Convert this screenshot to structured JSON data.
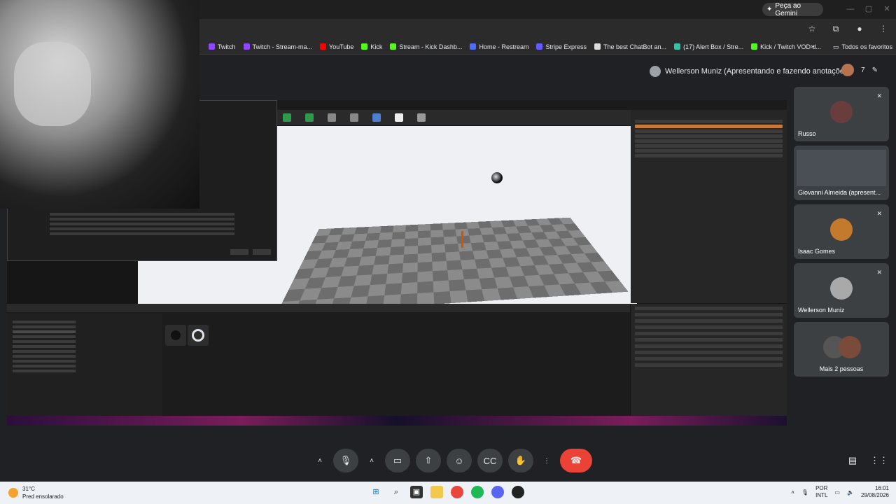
{
  "browser": {
    "gemini_label": "Peça ao Gemini",
    "bookmarks": [
      {
        "label": "Twitch",
        "color": "#9146ff"
      },
      {
        "label": "Twitch - Stream-ma...",
        "color": "#9146ff"
      },
      {
        "label": "YouTube",
        "color": "#ff0000"
      },
      {
        "label": "Kick",
        "color": "#53fc18"
      },
      {
        "label": "Stream - Kick Dashb...",
        "color": "#53fc18"
      },
      {
        "label": "Home - Restream",
        "color": "#4f6bff"
      },
      {
        "label": "Stripe Express",
        "color": "#635bff"
      },
      {
        "label": "The best ChatBot an...",
        "color": "#dddddd"
      },
      {
        "label": "(17) Alert Box / Stre...",
        "color": "#31c3a2"
      },
      {
        "label": "Kick / Twitch VOD d...",
        "color": "#53fc18"
      }
    ],
    "more_label": "»",
    "all_bookmarks_label": "Todos os favoritos"
  },
  "meet": {
    "presenter_label": "Wellerson Muniz (Apresentando e fazendo anotações)",
    "participant_count": "7",
    "participants": [
      {
        "name": "Russo",
        "avatar_color": "#6a3d3d"
      },
      {
        "name": "Giovanni Almeida (apresent...",
        "avatar_color": "#4a4f55"
      },
      {
        "name": "Isaac Gomes",
        "avatar_color": "#c47a2c"
      },
      {
        "name": "Wellerson Muniz",
        "avatar_color": "#a9a9a9"
      },
      {
        "name": "Mais 2 pessoas",
        "avatar_color": "#555"
      }
    ]
  },
  "system": {
    "temperature": "31°C",
    "weather_desc": "Pred ensolarado",
    "lang_top": "POR",
    "lang_bottom": "INTL",
    "time": "16:01",
    "date": "29/08/2026"
  }
}
